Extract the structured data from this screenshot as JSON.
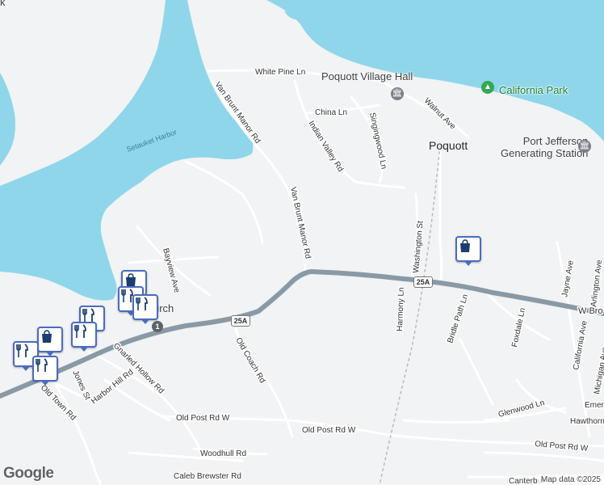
{
  "map": {
    "colors": {
      "land": "#f1f3f4",
      "water": "#8fd6ea",
      "road_minor": "#ffffff",
      "road_major": "#8a99a6",
      "pin_border": "#4a6bbf",
      "park": "#34a853",
      "poi_gray": "#7a8087"
    },
    "places": {
      "poquott": "Poquott",
      "poquott_village_hall": "Poquott Village Hall",
      "california_park": "California Park",
      "port_jefferson_line1": "Port Jefferson",
      "port_jefferson_line2": "Generating Station",
      "church_partial": "urch",
      "top_left_partial": "k"
    },
    "water": {
      "setauket_harbor": "Setauket Harbor"
    },
    "roads": {
      "white_pine_ln": "White Pine Ln",
      "china_ln": "China Ln",
      "singingwood_ln": "Singingwood Ln",
      "walnut_ave": "Walnut Ave",
      "indian_valley_rd": "Indian Valley Rd",
      "van_brunt_manor_rd_1": "Van Brunt Manor Rd",
      "van_brunt_manor_rd_2": "Van Brunt Manor Rd",
      "washington_st": "Washington St",
      "harmony_ln": "Harmony Ln",
      "bridle_path_ln": "Bridle Path Ln",
      "foxdale_ln": "Foxdale Ln",
      "jayne_ave": "Jayne Ave",
      "arlington_ave": "Arlington Ave",
      "california_ave": "California Ave",
      "michigan_ave": "Michigan Ave",
      "emerson_partial": "Emer",
      "hawthorne_partial": "Hawthorn",
      "w_broadway_partial": "W Bro",
      "glenwood_ln": "Glenwood Ln",
      "old_post_rd_w_1": "Old Post Rd W",
      "old_post_rd_w_2": "Old Post Rd W",
      "old_post_rd_w_3": "Old Post Rd W",
      "old_coach_rd": "Old Coach Rd",
      "bayview_ave": "Bayview Ave",
      "gnarled_hollow_rd": "Gnarled Hollow Rd",
      "harbor_hill_rd": "Harbor Hill Rd",
      "jones_st": "Jones St",
      "old_town_rd": "Old Town Rd",
      "woodhull_rd": "Woodhull Rd",
      "caleb_brewster_rd": "Caleb Brewster Rd",
      "canterbury_partial": "Canterbur"
    },
    "shields": {
      "route_25a_a": "25A",
      "route_25a_b": "25A",
      "route_1": "1"
    },
    "pins": [
      {
        "id": "shopping-east",
        "icon": "shopping-bag-icon"
      },
      {
        "id": "shopping-stack-top",
        "icon": "shopping-bag-icon"
      },
      {
        "id": "restaurant-1",
        "icon": "fork-knife-icon"
      },
      {
        "id": "restaurant-2",
        "icon": "fork-knife-icon"
      },
      {
        "id": "restaurant-3",
        "icon": "fork-knife-icon"
      },
      {
        "id": "shopping-cluster",
        "icon": "shopping-bag-icon"
      },
      {
        "id": "restaurant-4",
        "icon": "fork-knife-icon"
      },
      {
        "id": "restaurant-5",
        "icon": "fork-knife-icon"
      }
    ],
    "logo": "Google",
    "attribution": "Map data ©2025"
  }
}
